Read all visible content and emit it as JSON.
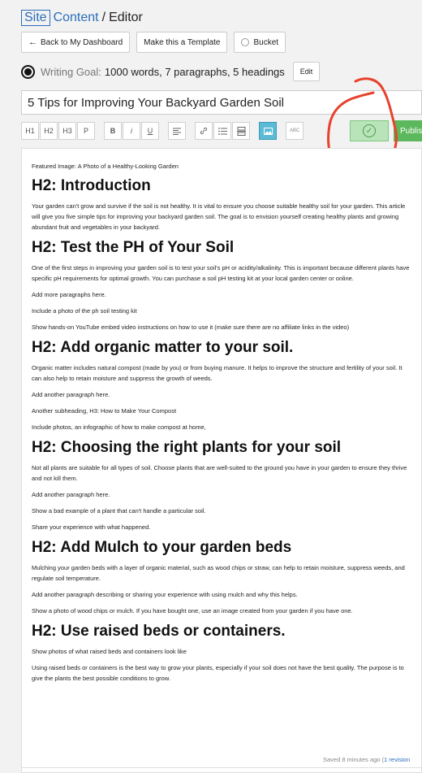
{
  "header": {
    "site": "Site",
    "content": "Content",
    "slash": "/",
    "editor": "Editor"
  },
  "buttons": {
    "dashboard": "Back to My Dashboard",
    "template": "Make this a Template",
    "bucket": "Bucket",
    "edit": "Edit",
    "publish": "Publish"
  },
  "goal": {
    "label": "Writing Goal:",
    "value": "1000 words, 7 paragraphs, 5 headings"
  },
  "title": "5 Tips for Improving Your Backyard Garden Soil",
  "toolbar": {
    "h1": "H1",
    "h2": "H2",
    "h3": "H3",
    "p": "P",
    "bold": "B",
    "italic": "i",
    "underline": "U",
    "abc": "ABC"
  },
  "doc": {
    "featured": "Featured Image: A Photo of a Healthy-Looking Garden",
    "h_intro": "H2: Introduction",
    "p_intro": "Your garden can't grow and survive if the soil is not healthy. It is vital to ensure you choose suitable healthy soil for your garden. This article will give you five simple tips for improving your backyard garden soil. The goal is to envision yourself creating healthy plants and growing abundant fruit and vegetables in your backyard.",
    "h_test": "H2: Test the PH of Your Soil",
    "p_test": "One of the first steps in improving your garden soil is to test your soil's pH or acidity/alkalinity. This is important because different plants have specific pH requirements for optimal growth. You can purchase a soil pH testing kit at your local garden center or online.",
    "p_test2": "Add more paragraphs here.",
    "p_test3": "Include a photo of the ph soil testing kit",
    "p_test4": "Show hands-on YouTube embed video instructions on how to use it (make sure there are no affiliate links in the video)",
    "h_organic": "H2:  Add organic matter to your soil.",
    "p_organic": "Organic matter includes natural compost (made by you) or from buying manure. It helps to improve the structure and fertility of your soil. It can also help to retain moisture and suppress the growth of weeds.",
    "p_organic2": "Add another paragraph here.",
    "p_organic3": "Another subheading, H3:  How to Make Your Compost",
    "p_organic4": "Include photos, an infographic of how to make compost at home,",
    "h_plants": "H2: Choosing the right plants for your soil",
    "p_plants": "Not all plants are suitable for all types of soil. Choose plants that are well-suited to the ground you have in your garden to ensure they thrive and not kill them.",
    "p_plants2": "Add another paragraph here.",
    "p_plants3": "Show a bad example of a plant that can't handle a particular soil.",
    "p_plants4": "Share your experience with what happened.",
    "h_mulch": "H2: Add Mulch to your garden beds",
    "p_mulch": "Mulching your garden beds with a layer of organic material, such as wood chips or straw, can help to retain moisture, suppress weeds, and regulate soil temperature.",
    "p_mulch2": "Add another paragraph describing or sharing your experience with using mulch and why this helps.",
    "p_mulch3": "Show a photo of wood chips or mulch. If you have bought one, use an image created from your garden if you have one.",
    "h_raised": "H2: Use raised beds or containers.",
    "p_raised": "Show photos of what raised beds and containers look like",
    "p_raised2": "Using raised beds or containers is the best way to grow your plants, especially if your soil does not have the best quality. The purpose is to give the plants the best possible conditions to grow."
  },
  "status": {
    "saved": "Saved 8 minutes ago (",
    "revisions": "1 revision"
  },
  "colors": {
    "link": "#2a6ebb",
    "publish": "#5cb85c",
    "save": "#b9e3b9",
    "annotation": "#e8412c"
  }
}
